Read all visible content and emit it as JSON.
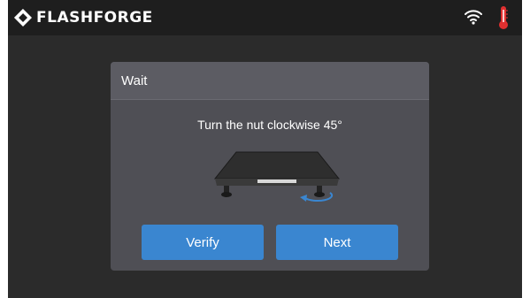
{
  "topbar": {
    "brand": "FLASHFORGE",
    "icons": [
      "flashforge-logo-icon",
      "wifi-icon",
      "thermometer-icon"
    ]
  },
  "dialog": {
    "title": "Wait",
    "instruction": "Turn the nut clockwise 45°",
    "illustration": "print-bed-leveling-nut-icon",
    "buttons": {
      "verify": "Verify",
      "next": "Next"
    }
  },
  "colors": {
    "screen_bg": "#2b2b2b",
    "topbar_bg": "#1e1e1e",
    "dialog_bg": "#4f4f55",
    "button": "#3a86d0",
    "thermometer": "#e03030",
    "rotation_arrow": "#3a86d0"
  }
}
